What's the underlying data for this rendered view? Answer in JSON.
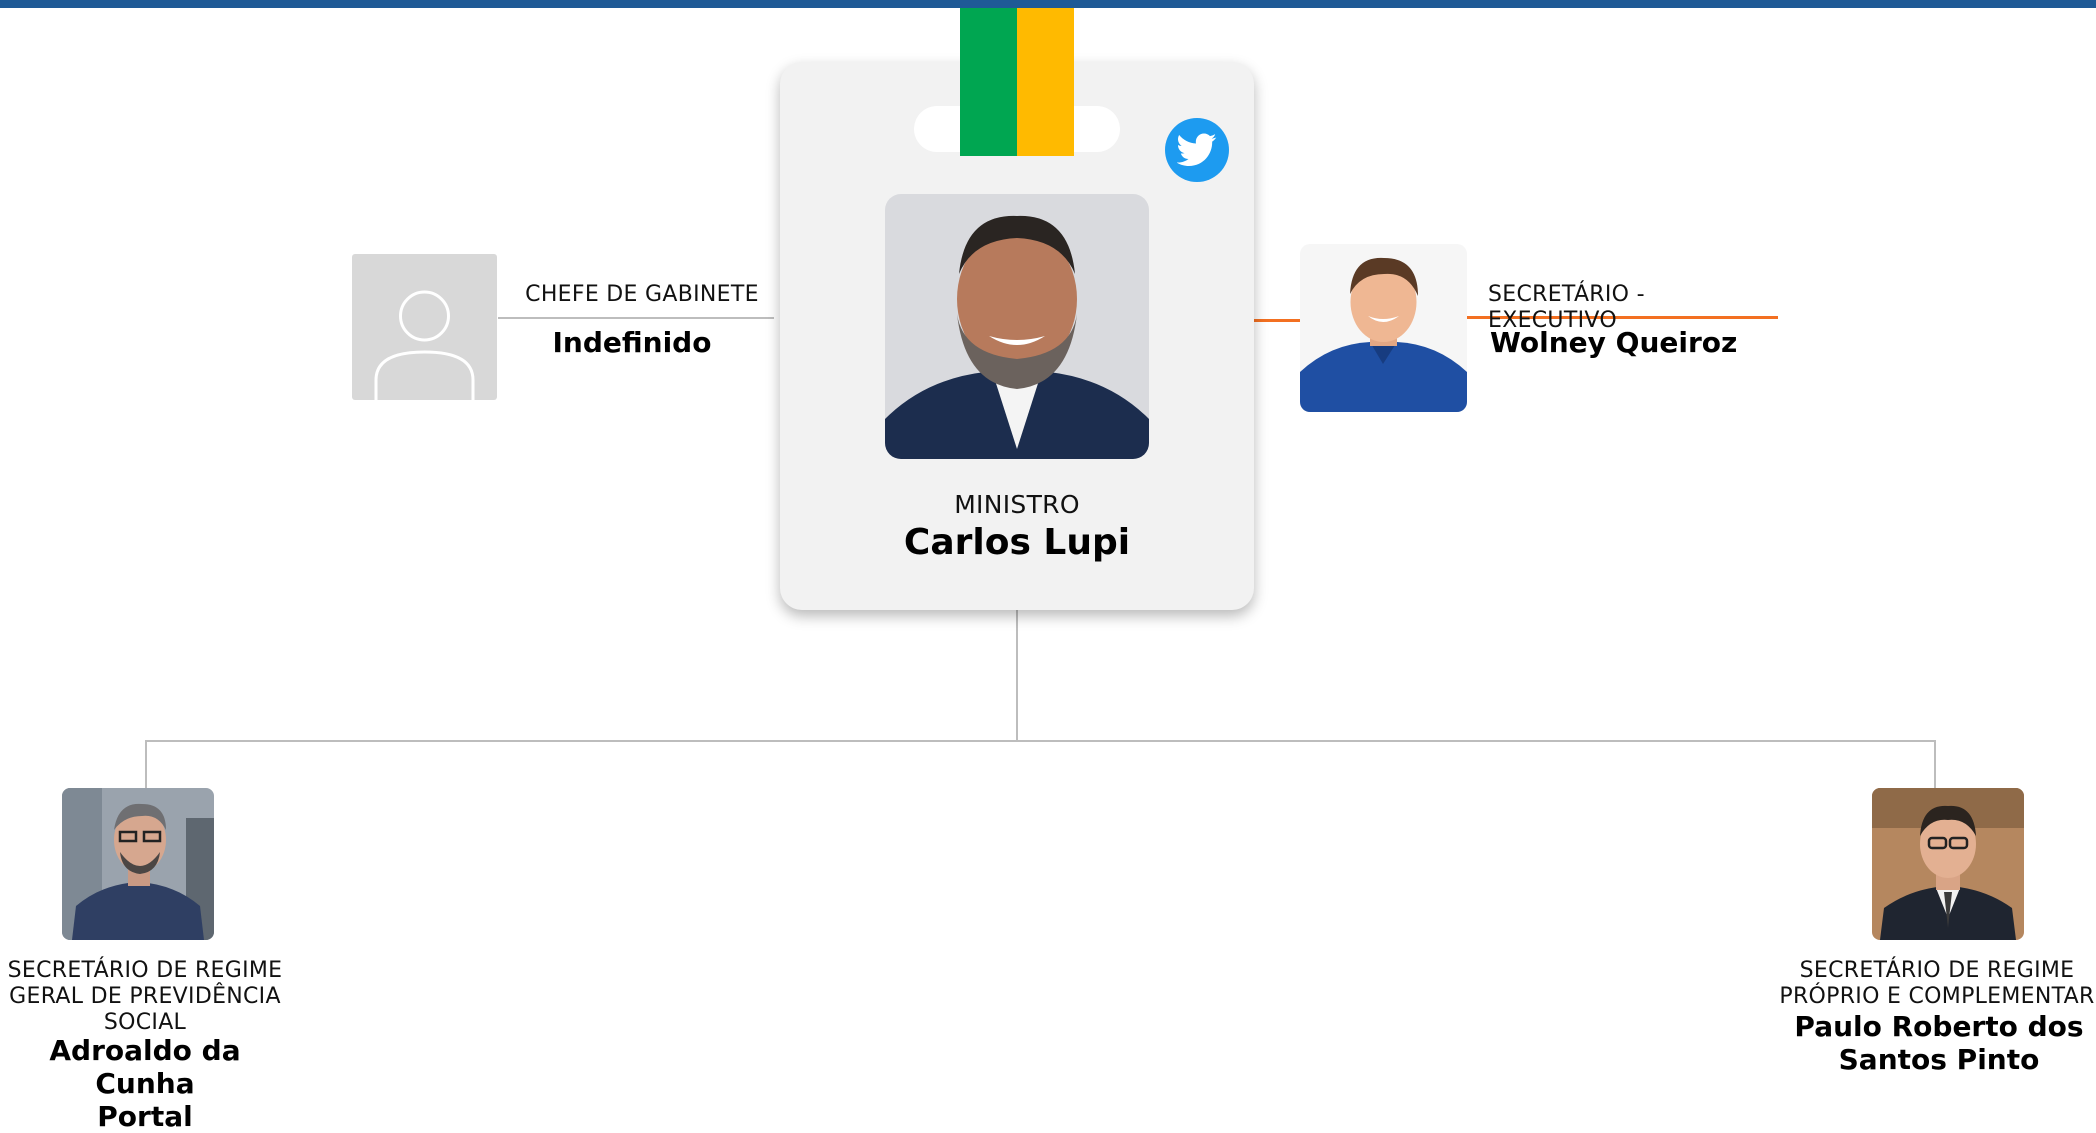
{
  "minister": {
    "role": "MINISTRO",
    "name": "Carlos Lupi",
    "social_icon": "twitter-icon"
  },
  "chief_of_staff": {
    "role": "CHEFE DE GABINETE",
    "name": "Indefinido",
    "photo_icon": "person-placeholder-icon"
  },
  "executive_secretary": {
    "role": "SECRETÁRIO - EXECUTIVO",
    "name": "Wolney Queiroz"
  },
  "secretaries": [
    {
      "role_lines": [
        "SECRETÁRIO DE REGIME",
        "GERAL DE PREVIDÊNCIA",
        "SOCIAL"
      ],
      "name_lines": [
        "Adroaldo da Cunha",
        "Portal"
      ]
    },
    {
      "role_lines": [
        "SECRETÁRIO DE REGIME",
        "PRÓPRIO E COMPLEMENTAR"
      ],
      "name_lines": [
        "Paulo Roberto dos",
        "Santos Pinto"
      ]
    }
  ],
  "colors": {
    "top_bar": "#1f5a96",
    "lanyard_green": "#00a651",
    "lanyard_yellow": "#ffba00",
    "twitter_blue": "#1d9bf0",
    "executive_link": "#f37021",
    "connector": "#bdbdbd"
  }
}
